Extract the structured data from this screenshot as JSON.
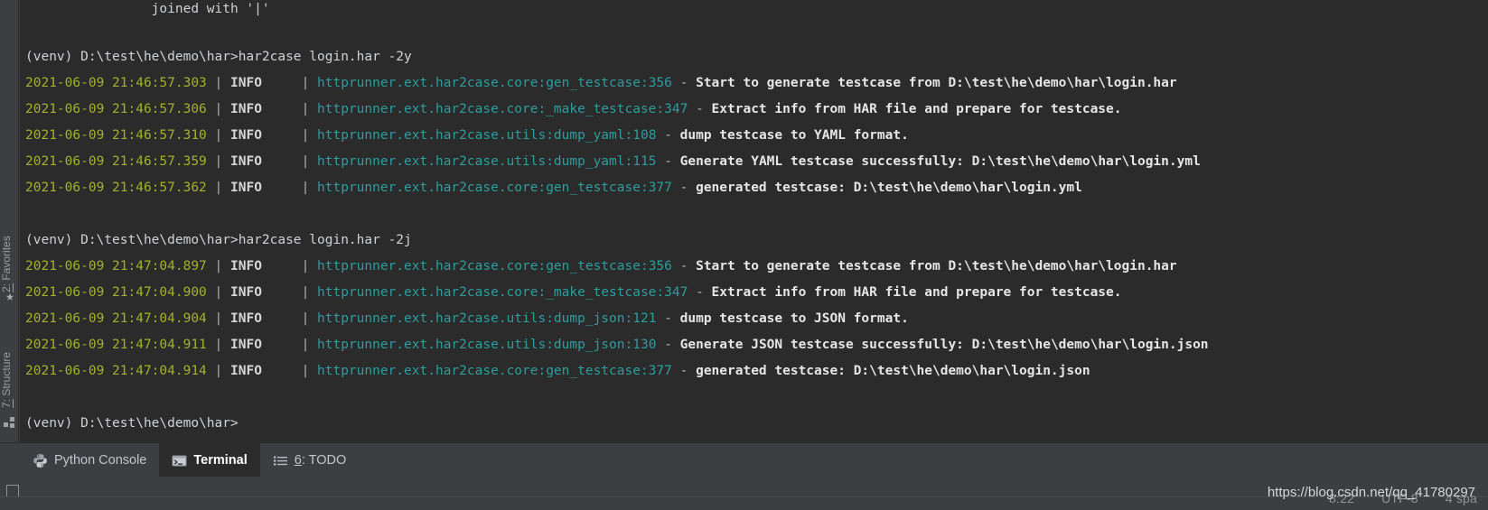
{
  "window": {
    "app": "PyCharm Terminal",
    "watermark": "https://blog.csdn.net/qq_41780297"
  },
  "sidebar": {
    "items": [
      {
        "label_num": "2:",
        "label_text": " Favorites",
        "icon": "star-icon"
      },
      {
        "label_num": "7:",
        "label_text": " Structure",
        "icon": "grid-icon"
      }
    ]
  },
  "terminal": {
    "lines": [
      {
        "type": "plain",
        "indent": "                ",
        "text": "joined with '|'"
      },
      {
        "type": "blank"
      },
      {
        "type": "prompt",
        "text": "(venv) D:\\test\\he\\demo\\har>har2case login.har -2y"
      },
      {
        "type": "log",
        "timestamp": "2021-06-09 21:46:57.303",
        "level": "INFO",
        "module": "httprunner.ext.har2case.core:gen_testcase:",
        "lineno": "356",
        "message": "Start to generate testcase from D:\\test\\he\\demo\\har\\login.har"
      },
      {
        "type": "log",
        "timestamp": "2021-06-09 21:46:57.306",
        "level": "INFO",
        "module": "httprunner.ext.har2case.core:_make_testcase:",
        "lineno": "347",
        "message": "Extract info from HAR file and prepare for testcase."
      },
      {
        "type": "log",
        "timestamp": "2021-06-09 21:46:57.310",
        "level": "INFO",
        "module": "httprunner.ext.har2case.utils:dump_yaml:",
        "lineno": "108",
        "message": "dump testcase to YAML format."
      },
      {
        "type": "log",
        "timestamp": "2021-06-09 21:46:57.359",
        "level": "INFO",
        "module": "httprunner.ext.har2case.utils:dump_yaml:",
        "lineno": "115",
        "message": "Generate YAML testcase successfully: D:\\test\\he\\demo\\har\\login.yml"
      },
      {
        "type": "log",
        "timestamp": "2021-06-09 21:46:57.362",
        "level": "INFO",
        "module": "httprunner.ext.har2case.core:gen_testcase:",
        "lineno": "377",
        "message": "generated testcase: D:\\test\\he\\demo\\har\\login.yml"
      },
      {
        "type": "blank"
      },
      {
        "type": "prompt",
        "text": "(venv) D:\\test\\he\\demo\\har>har2case login.har -2j"
      },
      {
        "type": "log",
        "timestamp": "2021-06-09 21:47:04.897",
        "level": "INFO",
        "module": "httprunner.ext.har2case.core:gen_testcase:",
        "lineno": "356",
        "message": "Start to generate testcase from D:\\test\\he\\demo\\har\\login.har"
      },
      {
        "type": "log",
        "timestamp": "2021-06-09 21:47:04.900",
        "level": "INFO",
        "module": "httprunner.ext.har2case.core:_make_testcase:",
        "lineno": "347",
        "message": "Extract info from HAR file and prepare for testcase."
      },
      {
        "type": "log",
        "timestamp": "2021-06-09 21:47:04.904",
        "level": "INFO",
        "module": "httprunner.ext.har2case.utils:dump_json:",
        "lineno": "121",
        "message": "dump testcase to JSON format."
      },
      {
        "type": "log",
        "timestamp": "2021-06-09 21:47:04.911",
        "level": "INFO",
        "module": "httprunner.ext.har2case.utils:dump_json:",
        "lineno": "130",
        "message": "Generate JSON testcase successfully: D:\\test\\he\\demo\\har\\login.json"
      },
      {
        "type": "log",
        "timestamp": "2021-06-09 21:47:04.914",
        "level": "INFO",
        "module": "httprunner.ext.har2case.core:gen_testcase:",
        "lineno": "377",
        "message": "generated testcase: D:\\test\\he\\demo\\har\\login.json"
      },
      {
        "type": "blank"
      },
      {
        "type": "prompt",
        "text": "(venv) D:\\test\\he\\demo\\har>"
      }
    ],
    "colors": {
      "background": "#2b2b2b",
      "timestamp": "#a1b22a",
      "level": "#d6d6d6",
      "module": "#2d9d9d",
      "message": "#e6e6e6",
      "prompt": "#cfd2d6"
    }
  },
  "tabs": [
    {
      "label": "Python Console",
      "icon": "python-icon",
      "active": false,
      "mnemonic": ""
    },
    {
      "label": "Terminal",
      "icon": "terminal-icon",
      "active": true,
      "mnemonic": ""
    },
    {
      "label": "6: TODO",
      "icon": "todo-list-icon",
      "active": false,
      "mnemonic": "6"
    }
  ],
  "statusbar": {
    "line_col": "8:22",
    "encoding": "UTF-8",
    "indent": "4 spa"
  }
}
